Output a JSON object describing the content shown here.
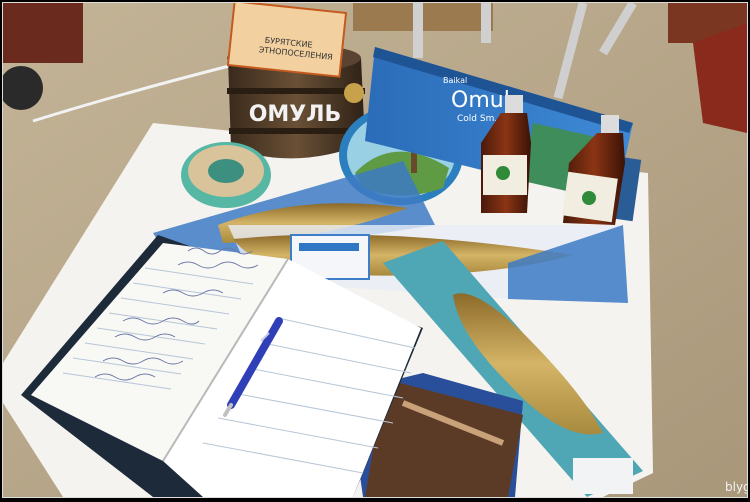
{
  "photo": {
    "barrel_label": "ОМУЛЬ",
    "sign_text_line1": "БУРЯТСКИЕ",
    "sign_text_line2": "ЭТНОПОСЕЛЕНИЯ",
    "box_brand": "Baikal",
    "box_title": "Omul",
    "box_subtitle": "Cold Sm...",
    "watermark": "blyg"
  },
  "colors": {
    "floor": "#b8a788",
    "tablecloth": "#f4f3ef",
    "box_blue": "#2f77c4",
    "fish_gold": "#b9953f",
    "pen_blue": "#2e3fb8",
    "notebook_cover": "#1d2a3a"
  }
}
